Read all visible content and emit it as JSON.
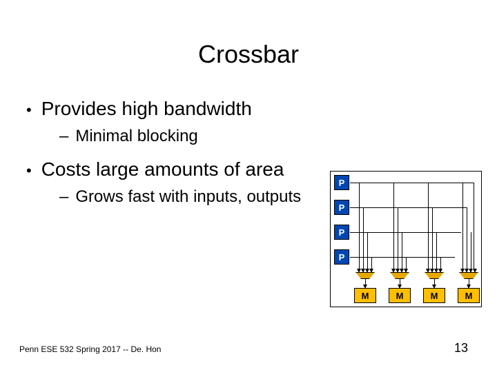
{
  "title": "Crossbar",
  "bullets": [
    {
      "level": 1,
      "text": "Provides high bandwidth"
    },
    {
      "level": 2,
      "text": "Minimal blocking"
    },
    {
      "level": 1,
      "text": "Costs large amounts of area"
    },
    {
      "level": 2,
      "text": "Grows fast with inputs, outputs"
    }
  ],
  "footer": "Penn ESE 532 Spring 2017 -- De. Hon",
  "page_number": "13",
  "diagram": {
    "processors": [
      "P",
      "P",
      "P",
      "P"
    ],
    "memories": [
      "M",
      "M",
      "M",
      "M"
    ]
  }
}
